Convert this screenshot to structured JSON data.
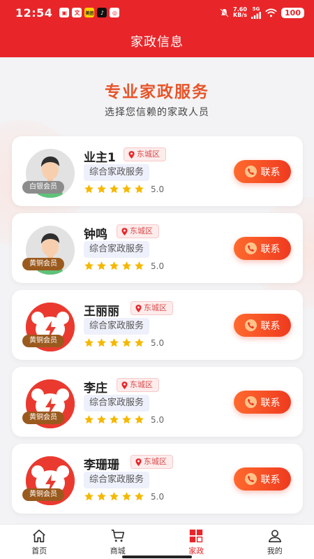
{
  "status": {
    "time": "12:54",
    "net_speed_value": "7.60",
    "net_speed_unit": "KB/s",
    "network": "5G",
    "battery": "100",
    "app_icons": [
      "文",
      "美团"
    ]
  },
  "header": {
    "title": "家政信息"
  },
  "hero": {
    "title": "专业家政服务",
    "subtitle": "选择您信赖的家政人员"
  },
  "workers": [
    {
      "name": "业主1",
      "location": "东城区",
      "service": "综合家政服务",
      "rating": "5.0",
      "stars": 5,
      "member": "白银会员",
      "avatar": "person"
    },
    {
      "name": "钟鸣",
      "location": "东城区",
      "service": "综合家政服务",
      "rating": "5.0",
      "stars": 5,
      "member": "黄铜会员",
      "avatar": "person"
    },
    {
      "name": "王丽丽",
      "location": "东城区",
      "service": "综合家政服务",
      "rating": "5.0",
      "stars": 5,
      "member": "黄铜会员",
      "avatar": "logo"
    },
    {
      "name": "李庄",
      "location": "东城区",
      "service": "综合家政服务",
      "rating": "5.0",
      "stars": 5,
      "member": "黄铜会员",
      "avatar": "logo"
    },
    {
      "name": "李珊珊",
      "location": "东城区",
      "service": "综合家政服务",
      "rating": "5.0",
      "stars": 5,
      "member": "黄铜会员",
      "avatar": "logo"
    }
  ],
  "contact_label": "联系",
  "tabs": [
    {
      "label": "首页",
      "icon": "home-icon"
    },
    {
      "label": "商城",
      "icon": "cart-icon"
    },
    {
      "label": "家政",
      "icon": "grid-icon",
      "active": true
    },
    {
      "label": "我的",
      "icon": "user-icon"
    }
  ],
  "colors": {
    "primary": "#e8262a",
    "accent": "#ff6a2e",
    "star": "#f5b800"
  }
}
